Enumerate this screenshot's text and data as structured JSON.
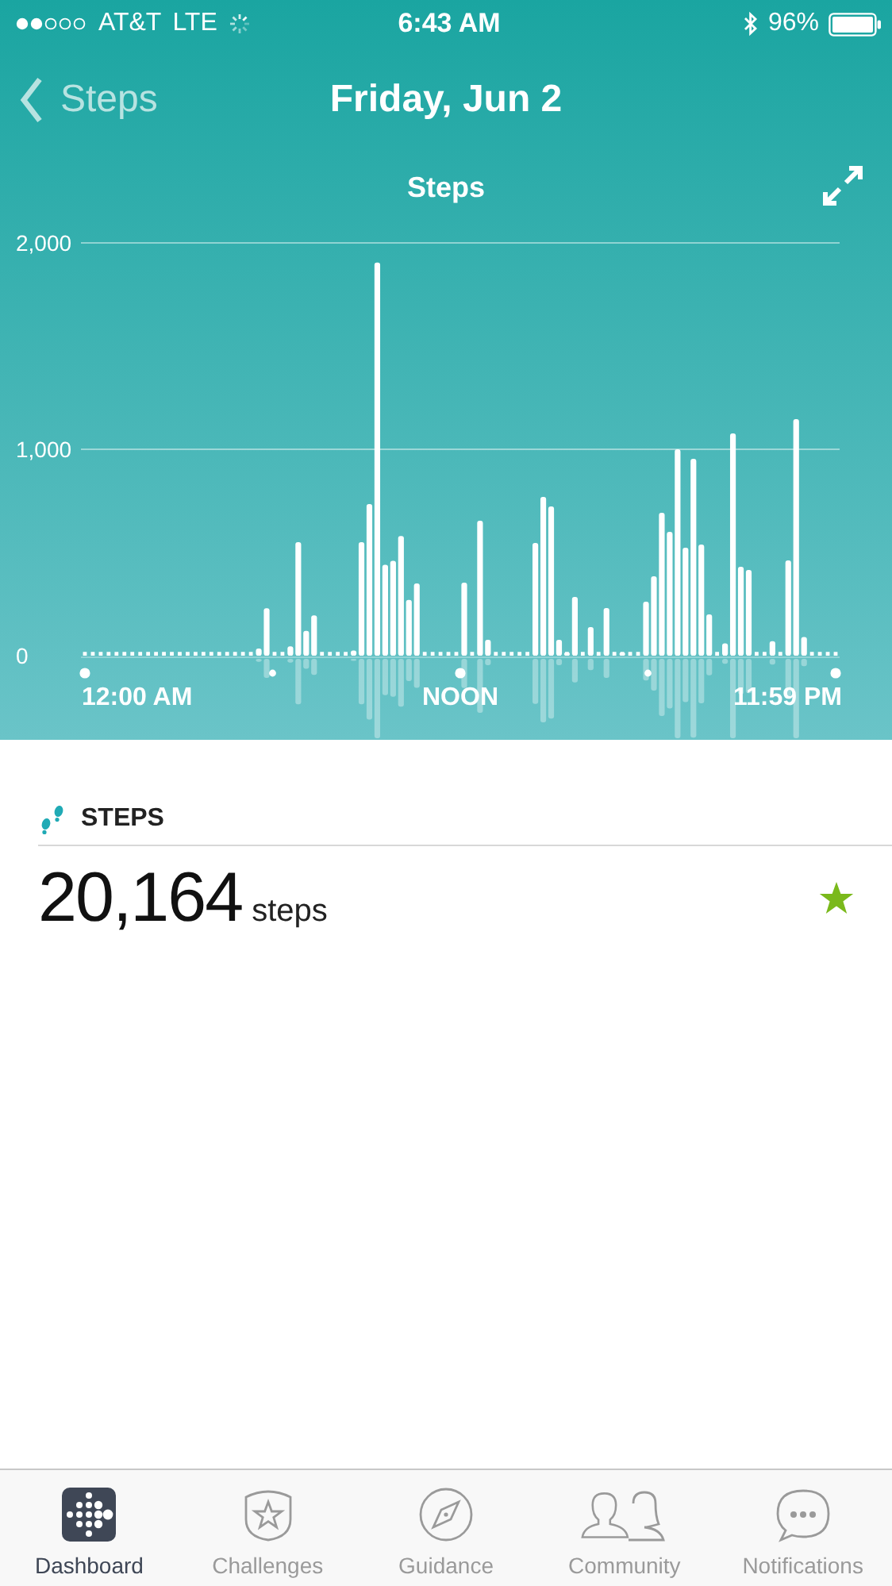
{
  "status_bar": {
    "carrier": "AT&T",
    "network": "LTE",
    "time": "6:43 AM",
    "battery": "96%"
  },
  "nav": {
    "back": "Steps",
    "title": "Friday, Jun 2"
  },
  "chart": {
    "x_labels": [
      "12:00 AM",
      "NOON",
      "11:59 PM"
    ],
    "chart_data": {
      "type": "bar",
      "title": "Steps",
      "ylim": [
        0,
        2000
      ],
      "yticks": [
        {
          "value": 0,
          "label": "0"
        },
        {
          "value": 1000,
          "label": "1,000"
        },
        {
          "value": 2000,
          "label": "2,000"
        }
      ],
      "series": [
        {
          "color": "#ffffff",
          "values": [
            0,
            0,
            0,
            0,
            0,
            0,
            0,
            0,
            0,
            0,
            0,
            0,
            0,
            0,
            0,
            0,
            0,
            0,
            0,
            0,
            0,
            0,
            35,
            230,
            0,
            0,
            45,
            550,
            120,
            195,
            0,
            0,
            0,
            0,
            25,
            550,
            735,
            1905,
            440,
            460,
            580,
            270,
            350,
            0,
            0,
            0,
            0,
            0,
            354,
            0,
            654,
            77,
            0,
            0,
            0,
            0,
            0,
            546,
            769,
            723,
            77,
            15,
            285,
            0,
            138,
            0,
            231,
            0,
            15,
            0,
            0,
            262,
            385,
            692,
            600,
            1000,
            523,
            954,
            538,
            200,
            0,
            60,
            1077,
            431,
            415,
            0,
            0,
            70,
            0,
            462,
            1146,
            90,
            0,
            0,
            0,
            0
          ]
        }
      ]
    }
  },
  "summary": {
    "heading": "STEPS",
    "value": "20,164",
    "unit": "steps",
    "goal_reached": true
  },
  "tabs": [
    {
      "label": "Dashboard",
      "selected": true
    },
    {
      "label": "Challenges",
      "selected": false
    },
    {
      "label": "Guidance",
      "selected": false
    },
    {
      "label": "Community",
      "selected": false
    },
    {
      "label": "Notifications",
      "selected": false
    }
  ]
}
